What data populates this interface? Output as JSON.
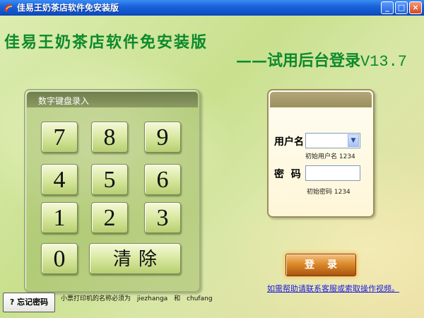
{
  "window": {
    "title": "佳易王奶茶店软件免安装版",
    "minimize_label": "_",
    "maximize_label": "□",
    "close_label": "×"
  },
  "header": {
    "main_title": "佳易王奶茶店软件免安装版",
    "sub_title": "——试用后台登录",
    "version": "V13.7"
  },
  "keypad": {
    "title": "数字键盘录入",
    "keys": [
      "7",
      "8",
      "9",
      "4",
      "5",
      "6",
      "1",
      "2",
      "3",
      "0"
    ],
    "clear_label": "清除"
  },
  "login": {
    "username_label": "用户名",
    "username_value": "",
    "username_hint": "初始用户名 1234",
    "password_label": "密  码",
    "password_value": "",
    "password_hint": "初始密码 1234",
    "submit_label": "登录"
  },
  "help_link": "如需帮助请联系客服或索取操作视频。",
  "forgot_label": "? 忘记密码",
  "notice": {
    "text": "小票打印机的名称必须为",
    "name1": "jiezhanga",
    "and": "和",
    "name2": "chufang"
  },
  "colors": {
    "title_text": "#0c8a2c",
    "titlebar": "#1a62d8",
    "login_button": "#dd8b2a",
    "link": "#1a1ae0"
  },
  "icons": {
    "app": "app-logo-icon",
    "dropdown": "chevron-down-icon"
  }
}
